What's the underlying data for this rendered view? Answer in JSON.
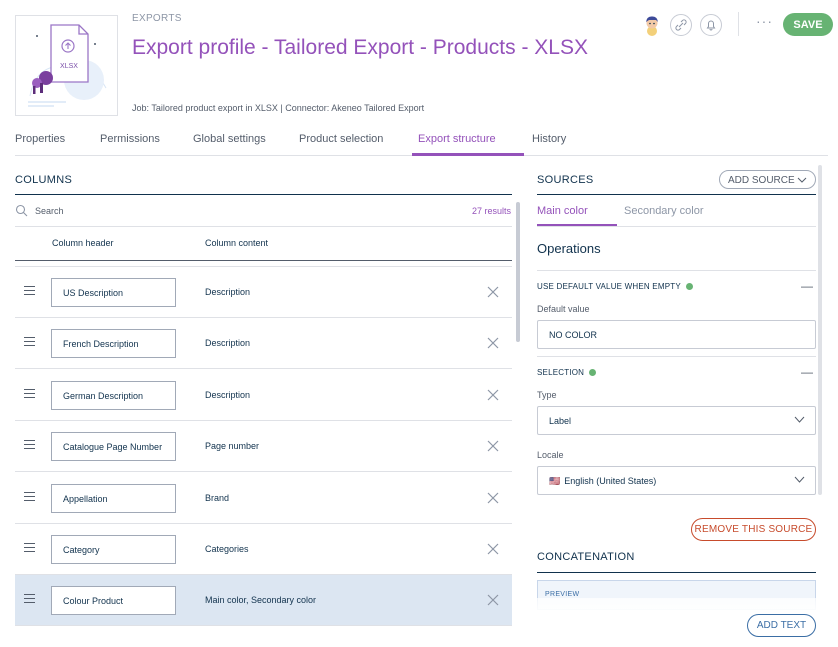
{
  "header": {
    "breadcrumb": "EXPORTS",
    "title": "Export profile - Tailored Export - Products - XLSX",
    "meta": "Job: Tailored product export in XLSX | Connector: Akeneo Tailored Export",
    "thumbnail_label": "XLSX",
    "save_label": "SAVE",
    "more_label": "···"
  },
  "tabs": [
    {
      "label": "Properties"
    },
    {
      "label": "Permissions"
    },
    {
      "label": "Global settings"
    },
    {
      "label": "Product selection"
    },
    {
      "label": "Export structure",
      "active": true
    },
    {
      "label": "History"
    }
  ],
  "columns": {
    "title": "COLUMNS",
    "search_placeholder": "Search",
    "results": "27 results",
    "col_header_label": "Column header",
    "col_content_label": "Column content",
    "rows": [
      {
        "header": "US Description",
        "content": "Description"
      },
      {
        "header": "French Description",
        "content": "Description"
      },
      {
        "header": "German Description",
        "content": "Description"
      },
      {
        "header": "Catalogue Page Number",
        "content": "Page number"
      },
      {
        "header": "Appellation",
        "content": "Brand"
      },
      {
        "header": "Category",
        "content": "Categories"
      },
      {
        "header": "Colour Product",
        "content": "Main color, Secondary color",
        "selected": true
      }
    ]
  },
  "sources": {
    "title": "SOURCES",
    "add_source_label": "ADD SOURCE",
    "tabs": [
      {
        "label": "Main color",
        "active": true
      },
      {
        "label": "Secondary color"
      }
    ],
    "operations_title": "Operations",
    "default_value": {
      "section_label": "USE DEFAULT VALUE WHEN EMPTY",
      "field_label": "Default value",
      "value": "NO COLOR"
    },
    "selection": {
      "section_label": "SELECTION",
      "type_label": "Type",
      "type_value": "Label",
      "locale_label": "Locale",
      "locale_flag": "🇺🇸",
      "locale_value": "English (United States)"
    },
    "remove_label": "REMOVE THIS SOURCE",
    "concatenation_title": "CONCATENATION",
    "preview_label": "PREVIEW",
    "add_text_label": "ADD TEXT"
  },
  "colors": {
    "accent": "#9452ba",
    "save": "#67b373",
    "status_dot": "#67b373",
    "danger": "#c74b2c",
    "link_blue": "#3b6ea5",
    "selected_row": "#dce6f2"
  }
}
